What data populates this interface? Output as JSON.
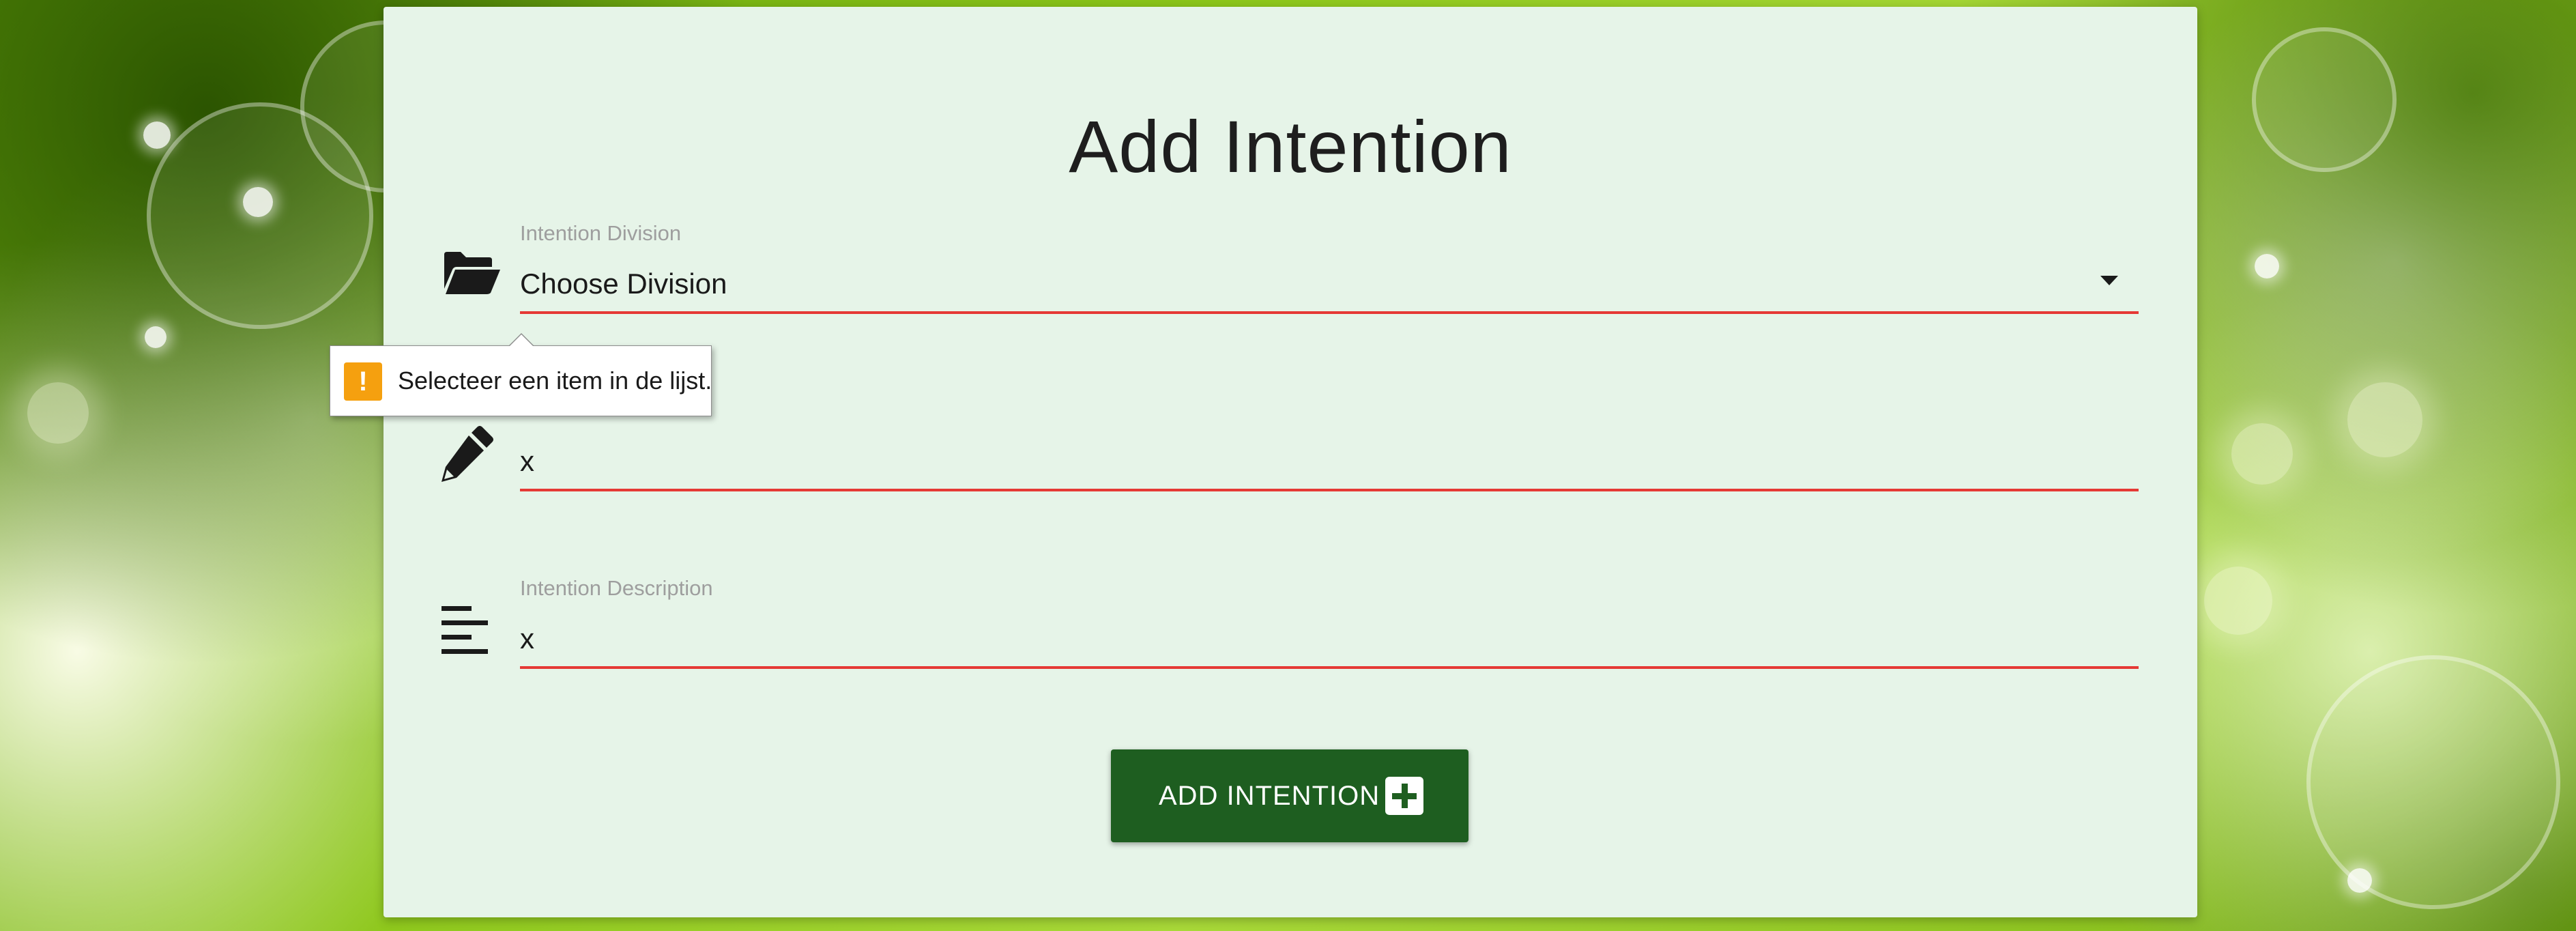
{
  "page": {
    "title": "Add Intention"
  },
  "form": {
    "division": {
      "label": "Intention Division",
      "value": "Choose Division",
      "icon": "folder-open-icon"
    },
    "name": {
      "value": "x",
      "icon": "pencil-icon"
    },
    "description": {
      "label": "Intention Description",
      "value": "x",
      "icon": "align-left-icon"
    },
    "validation_tooltip": {
      "message": "Selecteer een item in de lijst.",
      "icon": "warning-icon",
      "icon_glyph": "!"
    },
    "submit": {
      "label": "ADD INTENTION",
      "icon": "plus-square-icon"
    }
  },
  "colors": {
    "card_background": "#e6f4e8",
    "error_line": "#e53935",
    "button_background": "#1e5e20",
    "warning": "#f5a00f"
  }
}
